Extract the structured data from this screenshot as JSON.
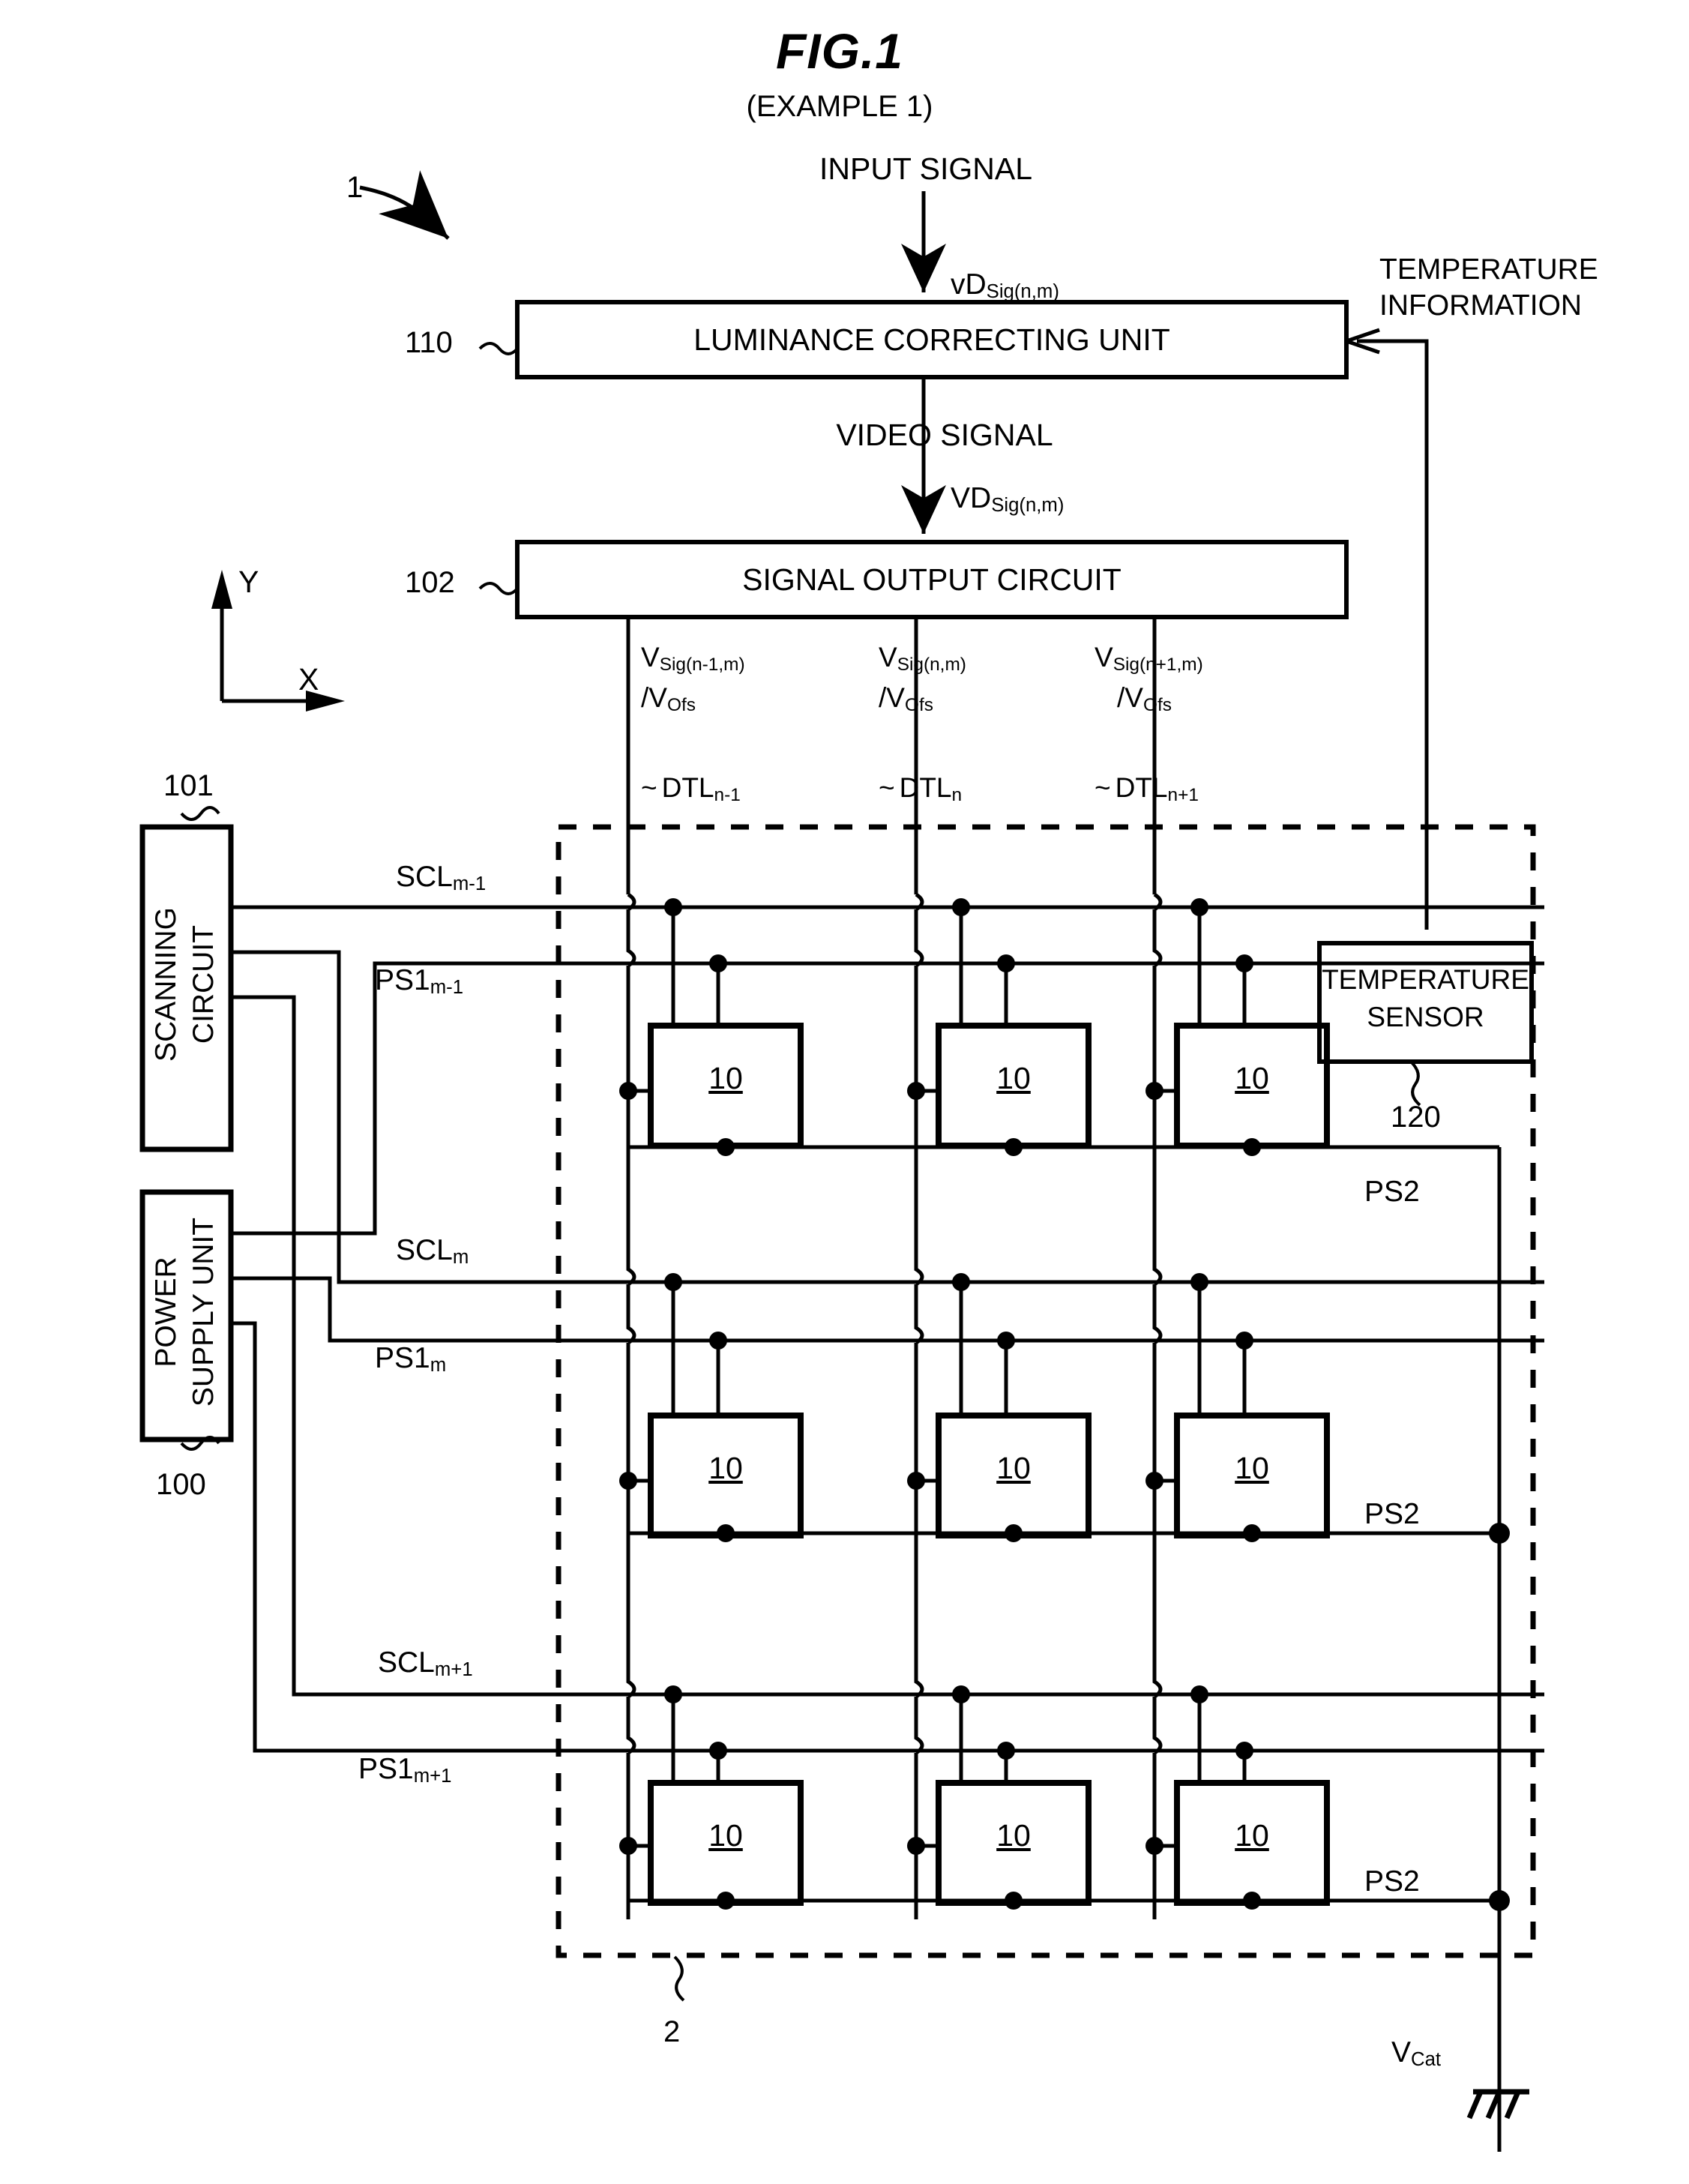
{
  "figure": {
    "title": "FIG.1",
    "subtitle": "(EXAMPLE 1)",
    "system_ref": "1",
    "panel_ref": "2"
  },
  "signals": {
    "input_signal": "INPUT SIGNAL",
    "input_signal_sym_main": "vD",
    "input_signal_sym_sub": "Sig(n,m)",
    "video_signal": "VIDEO SIGNAL",
    "video_signal_sym_main": "VD",
    "video_signal_sym_sub": "Sig(n,m)",
    "temperature_information_line1": "TEMPERATURE",
    "temperature_information_line2": "INFORMATION"
  },
  "blocks": {
    "luminance_correcting_unit": {
      "label": "LUMINANCE CORRECTING UNIT",
      "ref": "110"
    },
    "signal_output_circuit": {
      "label": "SIGNAL OUTPUT CIRCUIT",
      "ref": "102"
    },
    "scanning_circuit": {
      "line1": "SCANNING",
      "line2": "CIRCUIT",
      "ref": "101"
    },
    "power_supply_unit": {
      "line1": "POWER",
      "line2": "SUPPLY UNIT",
      "ref": "100"
    },
    "temperature_sensor": {
      "line1": "TEMPERATURE",
      "line2": "SENSOR",
      "ref": "120"
    }
  },
  "axes": {
    "x": "X",
    "y": "Y"
  },
  "columns": [
    {
      "vsig_main": "V",
      "vsig_sub": "Sig(n-1,m)",
      "vofs_main": "/V",
      "vofs_sub": "Ofs",
      "dtl_main": "DTL",
      "dtl_sub": "n-1"
    },
    {
      "vsig_main": "V",
      "vsig_sub": "Sig(n,m)",
      "vofs_main": "/V",
      "vofs_sub": "Ofs",
      "dtl_main": "DTL",
      "dtl_sub": "n"
    },
    {
      "vsig_main": "V",
      "vsig_sub": "Sig(n+1,m)",
      "vofs_main": "/V",
      "vofs_sub": "Ofs",
      "dtl_main": "DTL",
      "dtl_sub": "n+1"
    }
  ],
  "rows": [
    {
      "scl_main": "SCL",
      "scl_sub": "m-1",
      "ps1_main": "PS1",
      "ps1_sub": "m-1",
      "ps2": "PS2"
    },
    {
      "scl_main": "SCL",
      "scl_sub": "m",
      "ps1_main": "PS1",
      "ps1_sub": "m",
      "ps2": "PS2"
    },
    {
      "scl_main": "SCL",
      "scl_sub": "m+1",
      "ps1_main": "PS1",
      "ps1_sub": "m+1",
      "ps2": "PS2"
    }
  ],
  "pixel_cell_ref": "10",
  "ground": {
    "label_main": "V",
    "label_sub": "Cat"
  },
  "colors": {
    "ink": "#000000",
    "paper": "#ffffff"
  }
}
